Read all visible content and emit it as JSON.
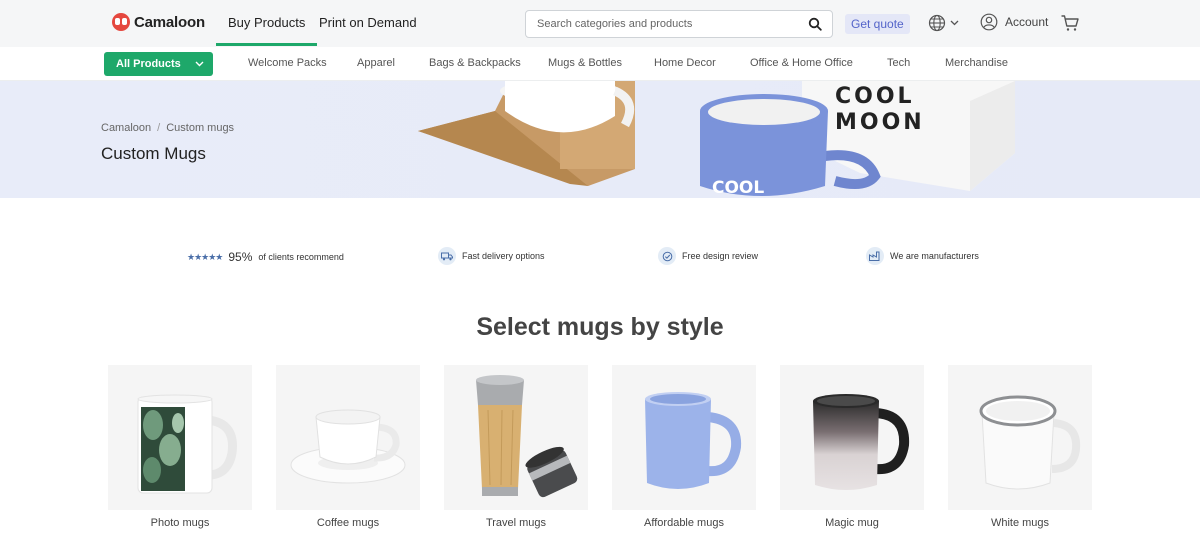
{
  "header": {
    "logo_text": "Camaloon",
    "tabs": [
      {
        "label": "Buy Products",
        "active": true
      },
      {
        "label": "Print on Demand",
        "active": false
      }
    ],
    "search_placeholder": "Search categories and products",
    "get_quote_label": "Get quote",
    "account_label": "Account"
  },
  "nav": {
    "all_products_label": "All Products",
    "links": [
      "Welcome Packs",
      "Apparel",
      "Bags & Backpacks",
      "Mugs & Bottles",
      "Home Decor",
      "Office & Home Office",
      "Tech",
      "Merchandise"
    ]
  },
  "hero": {
    "breadcrumb": [
      "Camaloon",
      "Custom mugs"
    ],
    "breadcrumb_sep": "/",
    "title": "Custom Mugs",
    "box_brand": [
      "COOL",
      "MOON"
    ],
    "mug_brand": "COOL"
  },
  "features": {
    "stars": "★★★★★",
    "rating_pct": "95%",
    "rating_text": "of clients recommend",
    "items": [
      "Fast delivery options",
      "Free design review",
      "We are manufacturers"
    ]
  },
  "section": {
    "title": "Select mugs by style",
    "cards": [
      "Photo mugs",
      "Coffee mugs",
      "Travel mugs",
      "Affordable mugs",
      "Magic mug",
      "White mugs"
    ]
  },
  "colors": {
    "accent": "#1ea86a",
    "brand_red": "#e5483f",
    "hero_bg": "#e7ebf8",
    "quote_text": "#5464c9",
    "mug_blue": "#7b93da"
  }
}
